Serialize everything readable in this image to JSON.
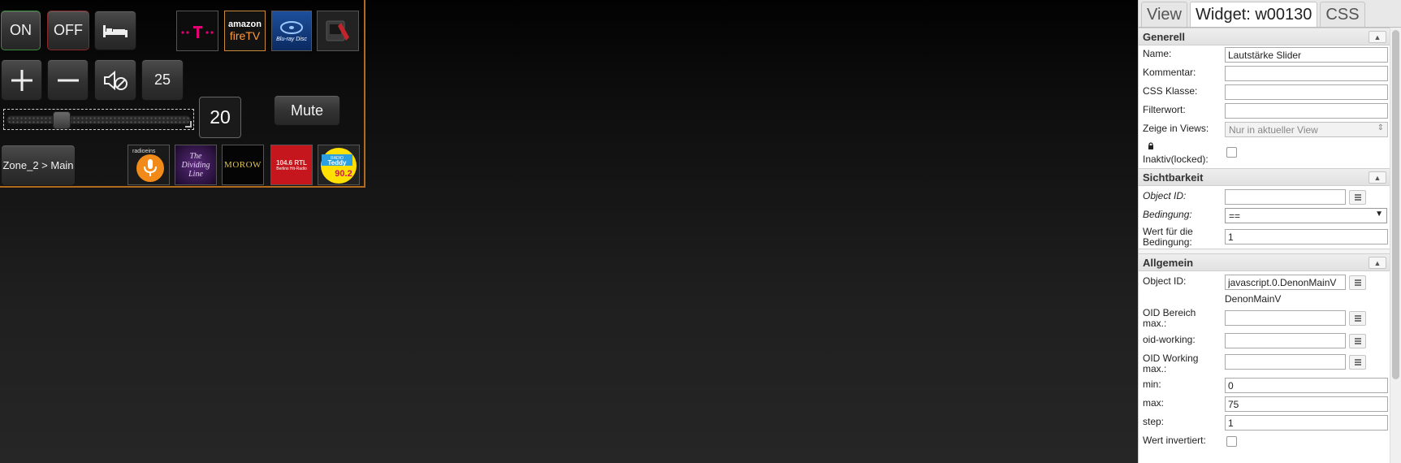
{
  "vis": {
    "buttons": {
      "on": "ON",
      "off": "OFF",
      "volume": "25",
      "mute": "Mute",
      "zone": "Zone_2 > Main"
    },
    "slider": {
      "value": "20",
      "level_fraction": 0.267
    },
    "sources": [
      {
        "icon": "telekom-icon",
        "label": "T"
      },
      {
        "icon": "amazon-fire-tv-icon",
        "label_top": "amazon",
        "label_bottom": "fireTV"
      },
      {
        "icon": "blu-ray-disc-icon",
        "label": "Blu-ray Disc"
      },
      {
        "icon": "media-device-icon"
      }
    ],
    "radios": [
      {
        "icon": "radio-eins-icon",
        "label": "radioeins"
      },
      {
        "icon": "dividing-line-icon",
        "label_top": "The",
        "label_mid": "Dividing",
        "label_bottom": "Line"
      },
      {
        "icon": "morow-icon",
        "label": "MOROW"
      },
      {
        "icon": "104-6-rtl-icon",
        "label_top": "104.6 RTL",
        "label_bottom": "Berlins Hit-Radio"
      },
      {
        "icon": "radio-teddy-icon",
        "label_top": "RADIO",
        "label_mid": "Teddy",
        "label_bottom": "90.2"
      }
    ],
    "colors": {
      "border": "#b36a1f",
      "on": "#3d8b3d",
      "off": "#8b2a2a"
    }
  },
  "editor": {
    "tabs": {
      "view": "View",
      "widget": "Widget: w00130",
      "css": "CSS"
    },
    "sections": {
      "generell": {
        "title": "Generell",
        "name_label": "Name:",
        "name_value": "Lautstärke Slider",
        "comment_label": "Kommentar:",
        "css_label": "CSS Klasse:",
        "filter_label": "Filterwort:",
        "views_label": "Zeige in Views:",
        "views_value": "Nur in aktueller View",
        "locked_label": "Inaktiv(locked):"
      },
      "sichtbarkeit": {
        "title": "Sichtbarkeit",
        "oid_label": "Object ID:",
        "condition_label": "Bedingung:",
        "condition_value": "==",
        "value_label": "Wert für die Bedingung:",
        "value_value": "1"
      },
      "allgemein": {
        "title": "Allgemein",
        "oid_label": "Object ID:",
        "oid_value": "javascript.0.DenonMainV",
        "oid_hint": "DenonMainV",
        "oid_max_label": "OID Bereich max.:",
        "oid_working_label": "oid-working:",
        "oid_working_max_label": "OID Working max.:",
        "min_label": "min:",
        "min_value": "0",
        "max_label": "max:",
        "max_value": "75",
        "step_label": "step:",
        "step_value": "1",
        "invert_label": "Wert invertiert:"
      }
    }
  }
}
